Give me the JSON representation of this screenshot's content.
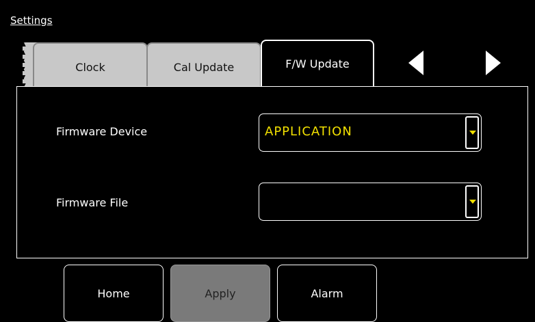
{
  "header": {
    "title": "Settings"
  },
  "tabs": [
    {
      "label": "Clock",
      "active": false
    },
    {
      "label": "Cal Update",
      "active": false
    },
    {
      "label": "F/W Update",
      "active": true
    }
  ],
  "tab_nav": {
    "prev_icon": "triangle-left",
    "next_icon": "triangle-right"
  },
  "form": {
    "firmware_device": {
      "label": "Firmware Device",
      "value": "APPLICATION"
    },
    "firmware_file": {
      "label": "Firmware File",
      "value": ""
    }
  },
  "footer": {
    "home_label": "Home",
    "apply_label": "Apply",
    "alarm_label": "Alarm"
  },
  "colors": {
    "background": "#000000",
    "value_text": "#f2e000",
    "inactive_tab": "#c8c8c8",
    "disabled_button": "#7a7a7a"
  }
}
